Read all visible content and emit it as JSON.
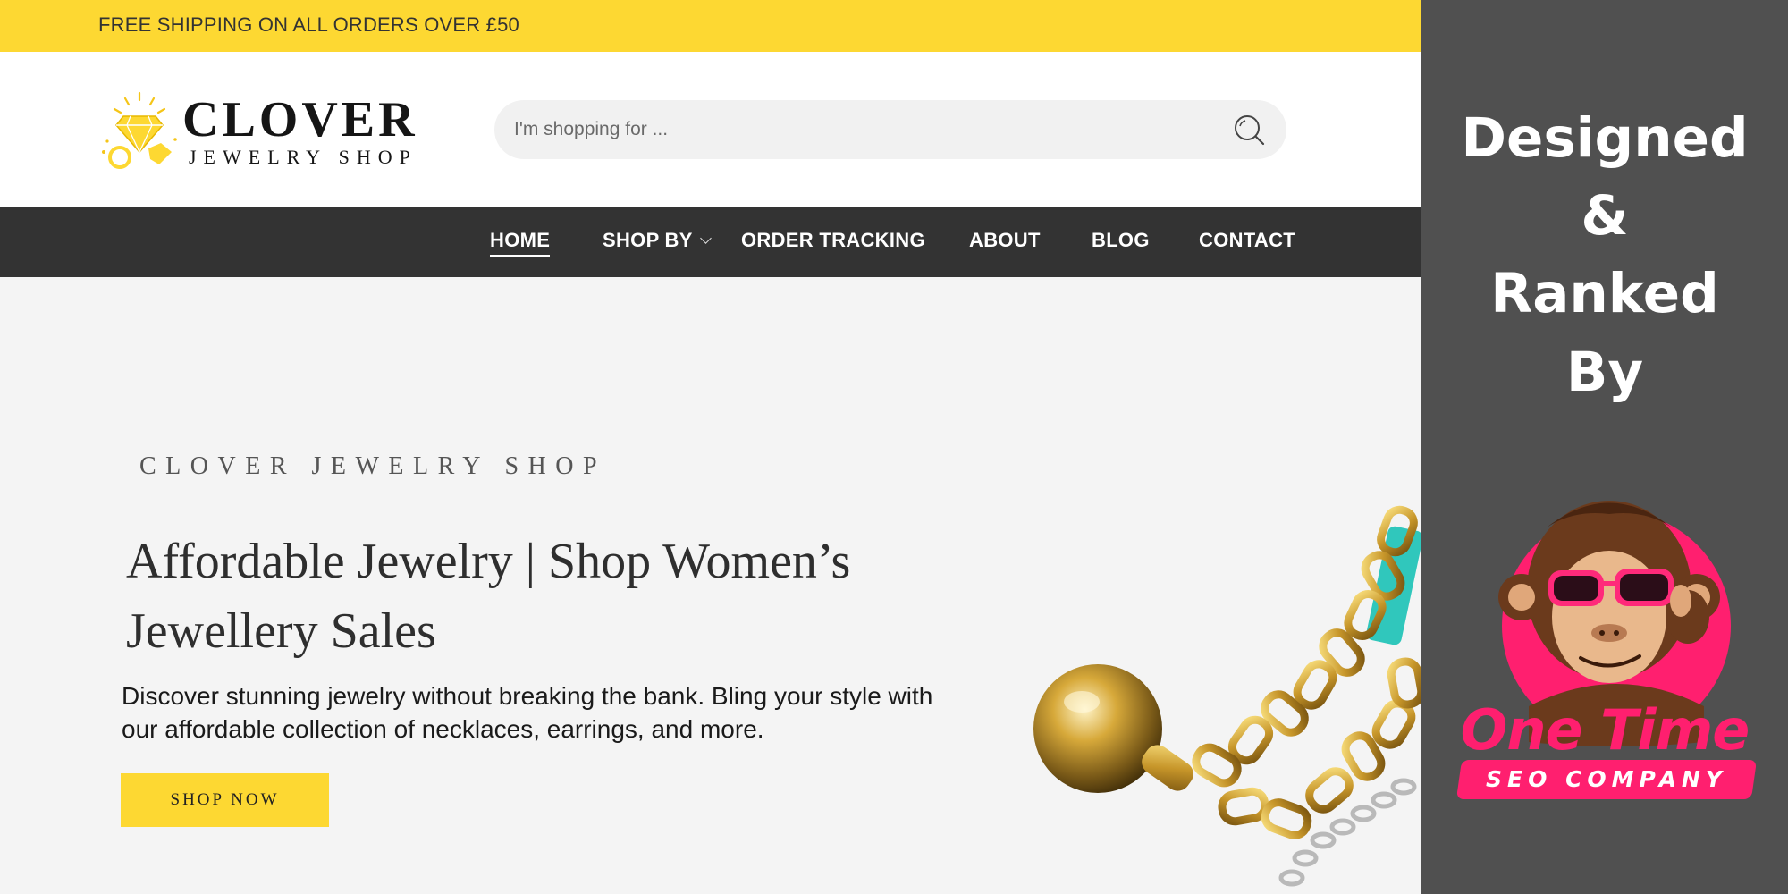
{
  "topbar": {
    "text": "FREE SHIPPING ON ALL ORDERS OVER £50"
  },
  "header": {
    "logo": {
      "title": "CLOVER",
      "subtitle": "JEWELRY SHOP"
    },
    "search": {
      "placeholder": "I'm shopping for ..."
    }
  },
  "nav": {
    "items": [
      {
        "label": "HOME",
        "active": true
      },
      {
        "label": "SHOP BY",
        "has_dropdown": true
      },
      {
        "label": "ORDER TRACKING"
      },
      {
        "label": "ABOUT"
      },
      {
        "label": "BLOG"
      },
      {
        "label": "CONTACT"
      }
    ]
  },
  "hero": {
    "brand": "CLOVER JEWELRY SHOP",
    "title": "Affordable Jewelry | Shop Women’s Jewellery Sales",
    "description": "Discover stunning jewelry without breaking the bank. Bling your style with our affordable collection of necklaces, earrings, and more.",
    "cta": "SHOP NOW"
  },
  "promo": {
    "lines": [
      "Designed",
      "&",
      "Ranked",
      "By"
    ],
    "brand_line1": "One Time",
    "brand_line2": "SEO COMPANY"
  },
  "colors": {
    "accent_yellow": "#fdd832",
    "nav_dark": "#333333",
    "promo_gray": "#505050",
    "brand_pink": "#ff1f6f"
  },
  "icons": {
    "search": "search-icon",
    "logo_mark": "diamond-rings-icon",
    "dropdown": "chevron-down-icon"
  }
}
